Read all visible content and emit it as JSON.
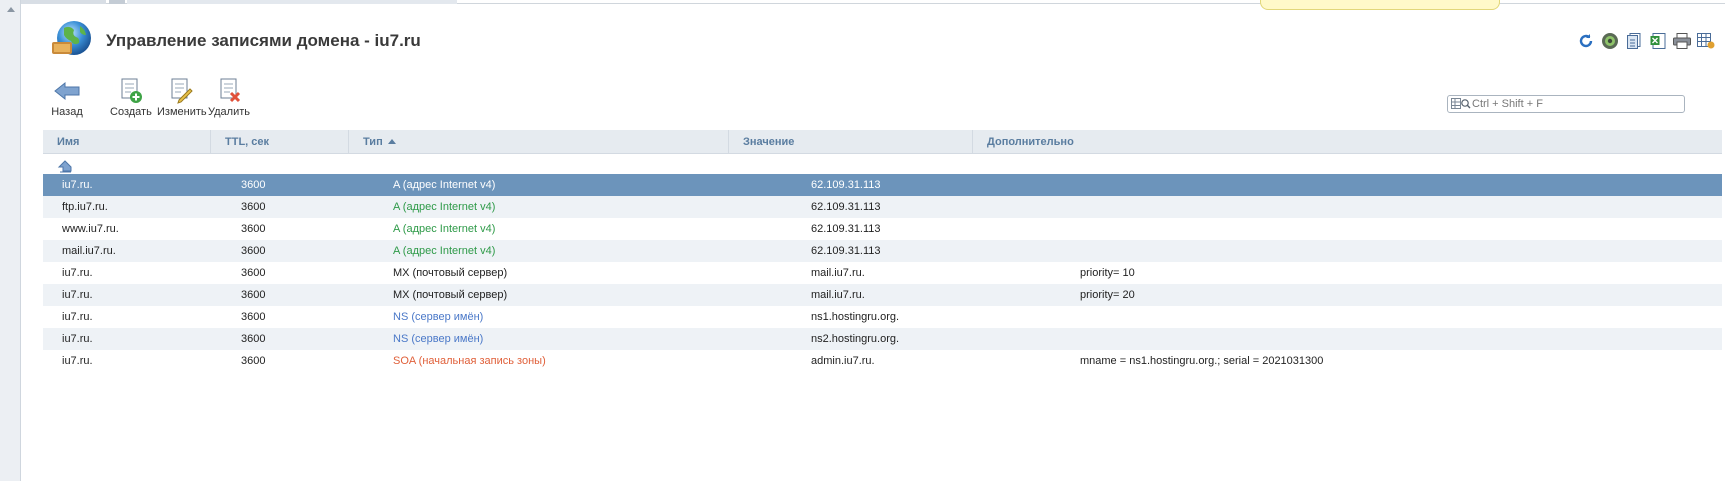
{
  "header": {
    "title": "Управление записями домена - iu7.ru"
  },
  "toolbar": {
    "back_label": "Назад",
    "create_label": "Создать",
    "edit_label": "Изменить",
    "delete_label": "Удалить"
  },
  "search": {
    "placeholder": "Ctrl + Shift + F"
  },
  "right_icons": [
    "refresh-icon",
    "settings-gear-icon",
    "copy-page-icon",
    "excel-export-icon",
    "print-icon",
    "table-settings-icon"
  ],
  "table": {
    "columns": [
      "Имя",
      "TTL, сек",
      "Тип",
      "Значение",
      "Дополнительно"
    ],
    "sorted_column": "Тип",
    "rows": [
      {
        "name": "iu7.ru.",
        "ttl": "3600",
        "type": "A (адрес Internet v4)",
        "kind": "A",
        "value": "62.109.31.113",
        "extra": "",
        "selected": true
      },
      {
        "name": "ftp.iu7.ru.",
        "ttl": "3600",
        "type": "A (адрес Internet v4)",
        "kind": "A",
        "value": "62.109.31.113",
        "extra": ""
      },
      {
        "name": "www.iu7.ru.",
        "ttl": "3600",
        "type": "A (адрес Internet v4)",
        "kind": "A",
        "value": "62.109.31.113",
        "extra": ""
      },
      {
        "name": "mail.iu7.ru.",
        "ttl": "3600",
        "type": "A (адрес Internet v4)",
        "kind": "A",
        "value": "62.109.31.113",
        "extra": ""
      },
      {
        "name": "iu7.ru.",
        "ttl": "3600",
        "type": "MX (почтовый сервер)",
        "kind": "MX",
        "value": "mail.iu7.ru.",
        "extra": "priority= 10"
      },
      {
        "name": "iu7.ru.",
        "ttl": "3600",
        "type": "MX (почтовый сервер)",
        "kind": "MX",
        "value": "mail.iu7.ru.",
        "extra": "priority= 20"
      },
      {
        "name": "iu7.ru.",
        "ttl": "3600",
        "type": "NS (сервер имён)",
        "kind": "NS",
        "value": "ns1.hostingru.org.",
        "extra": ""
      },
      {
        "name": "iu7.ru.",
        "ttl": "3600",
        "type": "NS (сервер имён)",
        "kind": "NS",
        "value": "ns2.hostingru.org.",
        "extra": ""
      },
      {
        "name": "iu7.ru.",
        "ttl": "3600",
        "type": "SOA (начальная запись зоны)",
        "kind": "SOA",
        "value": "admin.iu7.ru.",
        "extra": "mname = ns1.hostingru.org.; serial = 2021031300"
      }
    ]
  },
  "colors": {
    "selected_row": "#6c94bb",
    "type_A": "#2e9a48",
    "type_NS": "#4a78c8",
    "type_SOA": "#e0603a",
    "header_text": "#5a7da0"
  }
}
